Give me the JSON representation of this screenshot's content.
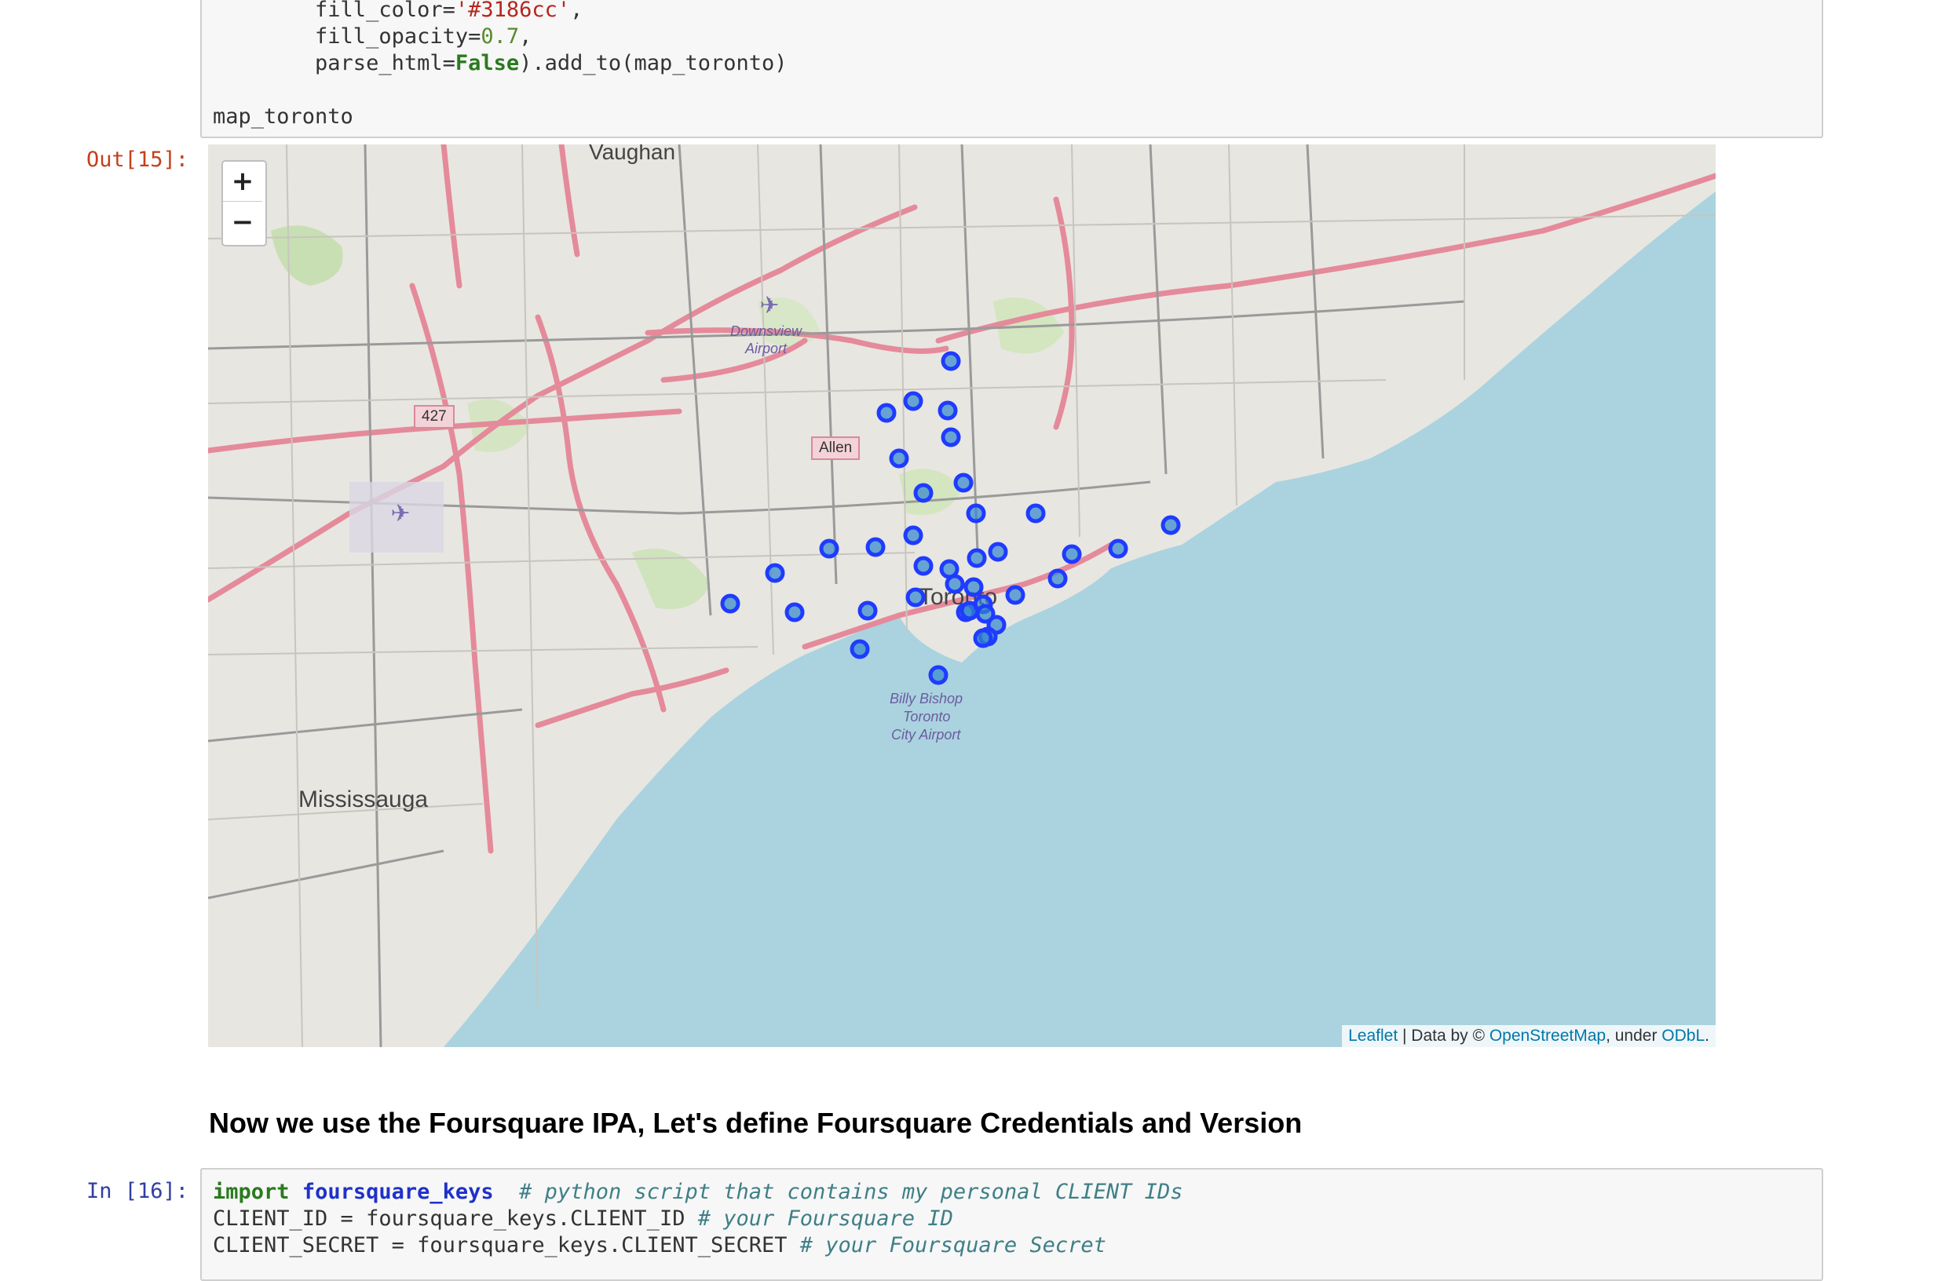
{
  "cell15": {
    "lines": {
      "l1_a": "        fill_color=",
      "l1_b": "'#3186cc'",
      "l1_c": ",",
      "l2_a": "        fill_opacity=",
      "l2_b": "0.7",
      "l2_c": ",",
      "l3_a": "        parse_html=",
      "l3_b": "False",
      "l3_c": ").add_to(map_toronto)",
      "l4": "map_toronto"
    },
    "out_prompt": "Out[15]:"
  },
  "map": {
    "zoom_in": "+",
    "zoom_out": "−",
    "marker_color": "#1f3bff",
    "marker_fill": "#3186cc",
    "labels": {
      "vaughan": "Vaughan",
      "mississauga": "Mississauga",
      "toronto": "Toronto",
      "downsview_1": "Downsview",
      "downsview_2": "Airport",
      "billy_1": "Billy Bishop",
      "billy_2": "Toronto",
      "billy_3": "City Airport",
      "allen": "Allen",
      "hwy427": "427"
    },
    "attribution": {
      "leaflet": "Leaflet",
      "mid": " | Data by © ",
      "osm": "OpenStreetMap",
      "under": ", under ",
      "odbl": "ODbL",
      "end": "."
    }
  },
  "markdown": {
    "heading": "Now we use the Foursquare IPA, Let's define Foursquare Credentials and Version"
  },
  "cell16": {
    "in_prompt": "In [16]:",
    "line1_kw": "import",
    "line1_mod": "foursquare_keys",
    "line1_cm": "# python script that contains my personal CLIENT IDs",
    "line2_code": "CLIENT_ID = foursquare_keys.CLIENT_ID ",
    "line2_cm": "# your Foursquare ID",
    "line3_code": "CLIENT_SECRET = foursquare_keys.CLIENT_SECRET ",
    "line3_cm": "# your Foursquare Secret"
  }
}
